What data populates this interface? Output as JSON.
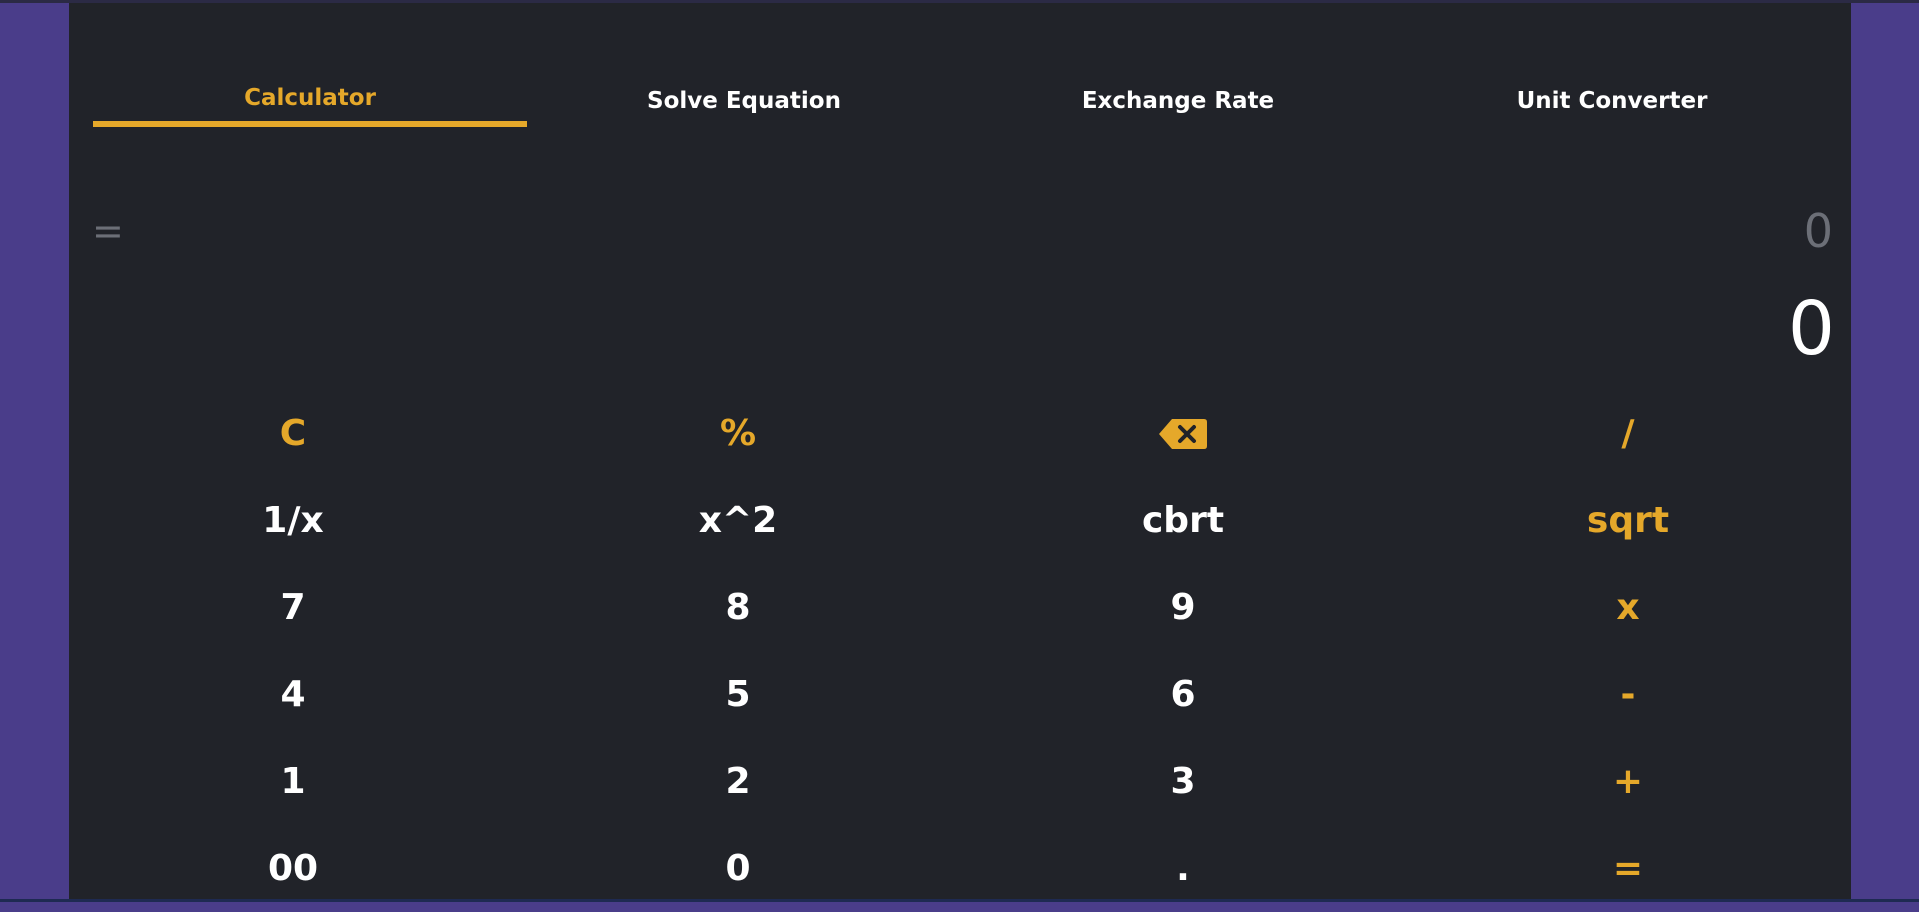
{
  "tabs": [
    {
      "label": "Calculator",
      "active": true
    },
    {
      "label": "Solve Equation",
      "active": false
    },
    {
      "label": "Exchange Rate",
      "active": false
    },
    {
      "label": "Unit Converter",
      "active": false
    }
  ],
  "display": {
    "equals_sign": "=",
    "expression": "0",
    "result": "0"
  },
  "keypad": {
    "rows": [
      [
        "C",
        "%",
        "backspace-icon",
        "/"
      ],
      [
        "1/x",
        "x^2",
        "cbrt",
        "sqrt"
      ],
      [
        "7",
        "8",
        "9",
        "x"
      ],
      [
        "4",
        "5",
        "6",
        "-"
      ],
      [
        "1",
        "2",
        "3",
        "+"
      ],
      [
        "00",
        "0",
        ".",
        "="
      ]
    ],
    "labels": {
      "clear": "C",
      "percent": "%",
      "divide": "/",
      "reciprocal": "1/x",
      "square": "x^2",
      "cube_root": "cbrt",
      "square_root": "sqrt",
      "seven": "7",
      "eight": "8",
      "nine": "9",
      "multiply": "x",
      "four": "4",
      "five": "5",
      "six": "6",
      "subtract": "-",
      "one": "1",
      "two": "2",
      "three": "3",
      "add": "+",
      "double_zero": "00",
      "zero": "0",
      "decimal": ".",
      "equals": "="
    }
  },
  "colors": {
    "accent": "#e5a82a",
    "background": "#212329",
    "frame": "#4a3d8a",
    "text": "#ffffff",
    "muted": "#6c6f77"
  }
}
